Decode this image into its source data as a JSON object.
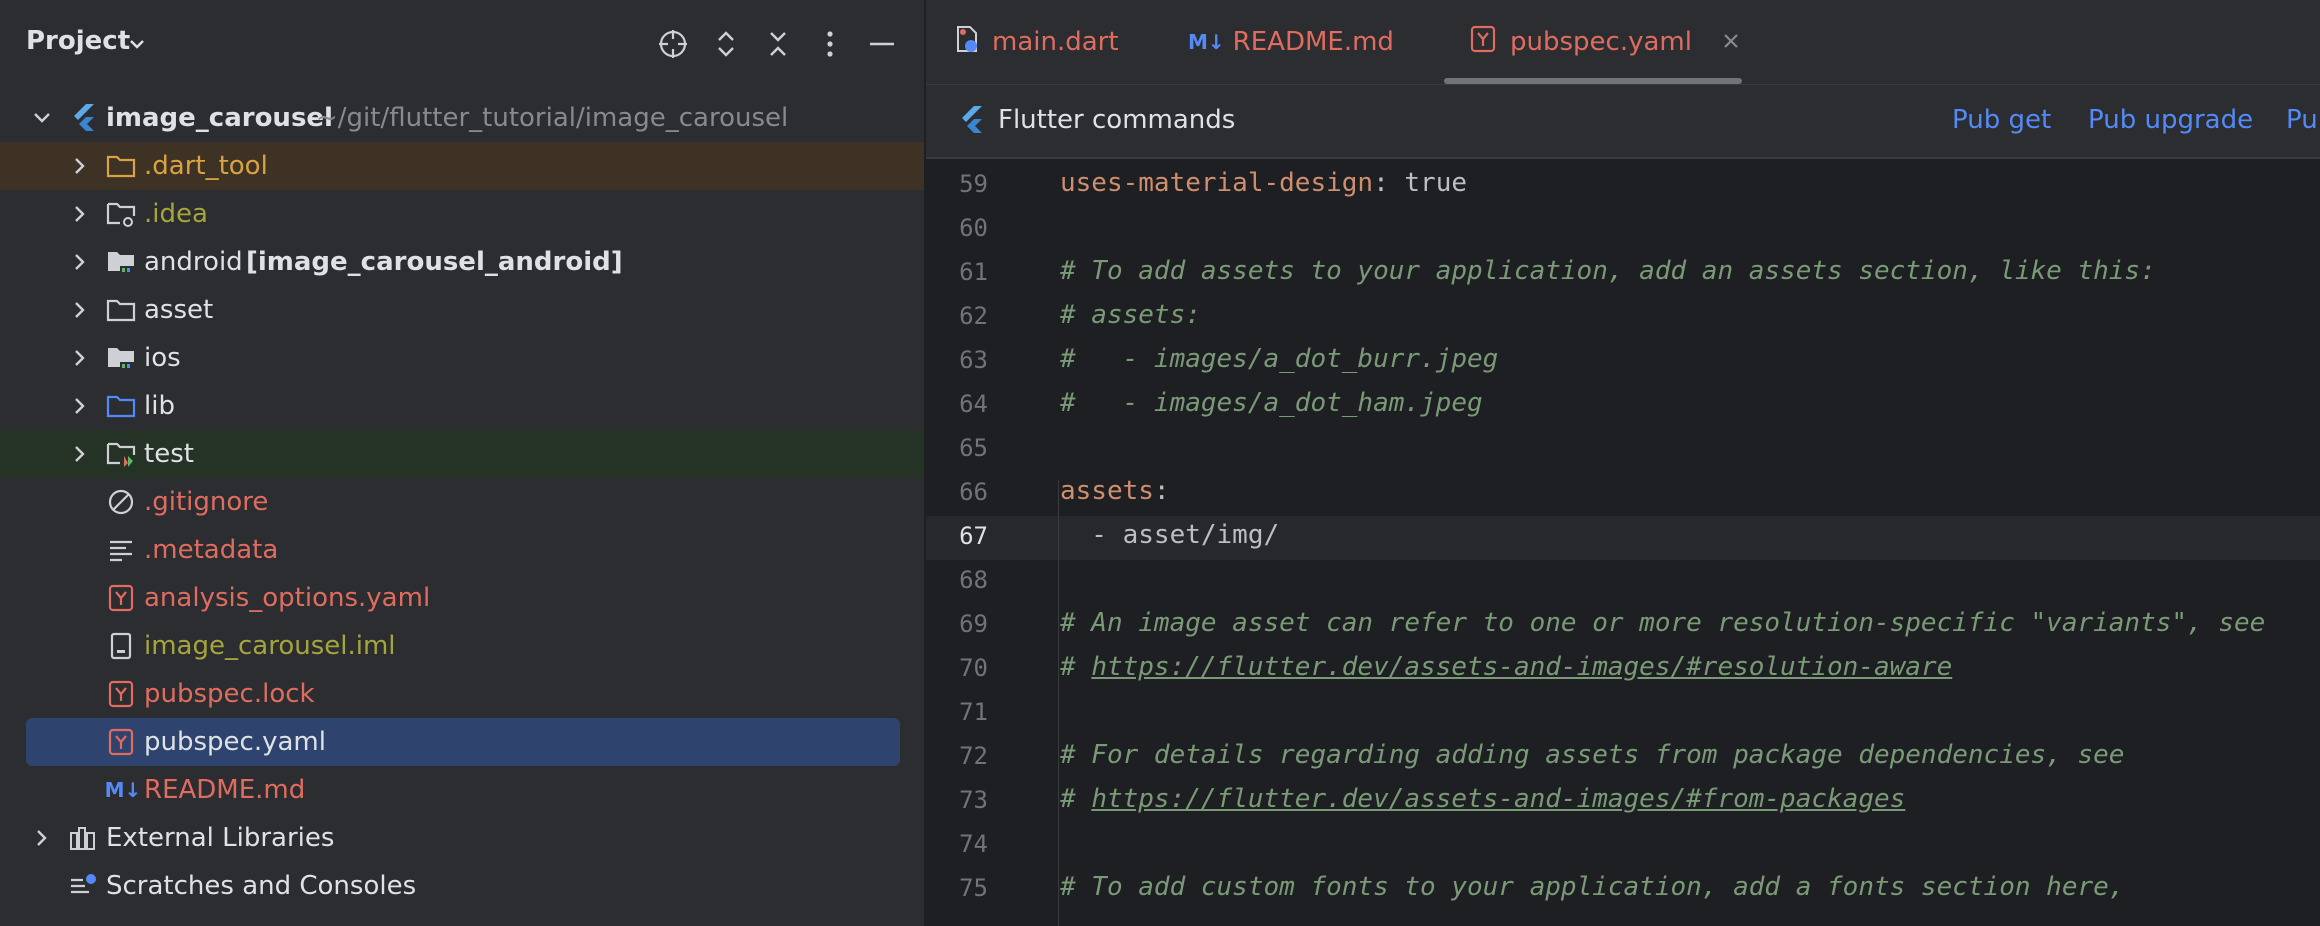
{
  "project_panel": {
    "title": "Project",
    "root": {
      "name": "image_carousel",
      "path": "~/git/flutter_tutorial/image_carousel"
    },
    "items": [
      {
        "label": ".dart_tool",
        "color": "#d9a343"
      },
      {
        "label": ".idea",
        "color": "#a6a43b"
      },
      {
        "label": "android",
        "extra": "[image_carousel_android]",
        "color": "#dfe1e5"
      },
      {
        "label": "asset",
        "color": "#dfe1e5"
      },
      {
        "label": "ios",
        "color": "#dfe1e5"
      },
      {
        "label": "lib",
        "color": "#dfe1e5"
      },
      {
        "label": "test",
        "color": "#dfe1e5"
      },
      {
        "label": ".gitignore",
        "color": "#e06c60"
      },
      {
        "label": ".metadata",
        "color": "#e06c60"
      },
      {
        "label": "analysis_options.yaml",
        "color": "#e06c60"
      },
      {
        "label": "image_carousel.iml",
        "color": "#a6a43b"
      },
      {
        "label": "pubspec.lock",
        "color": "#e06c60"
      },
      {
        "label": "pubspec.yaml",
        "color": "#dfe1e5"
      },
      {
        "label": "README.md",
        "color": "#e06c60"
      }
    ],
    "external_libraries": "External Libraries",
    "scratches": "Scratches and Consoles"
  },
  "editor": {
    "tabs": [
      {
        "label": "main.dart",
        "color": "#e06c60"
      },
      {
        "label": "README.md",
        "color": "#e06c60"
      },
      {
        "label": "pubspec.yaml",
        "color": "#e06c60",
        "active": true
      }
    ],
    "md_badge": "M↓",
    "toolbar": {
      "title": "Flutter commands",
      "pub_get": "Pub get",
      "pub_upgrade": "Pub upgrade",
      "pub_more": "Pu"
    },
    "current_line": "67",
    "lines": [
      {
        "n": "59",
        "key": "uses-material-design",
        "rest": ": true"
      },
      {
        "n": "60",
        "text": ""
      },
      {
        "n": "61",
        "comment": "# To add assets to your application, add an assets section, like this:"
      },
      {
        "n": "62",
        "comment": "# assets:"
      },
      {
        "n": "63",
        "comment": "#   - images/a_dot_burr.jpeg"
      },
      {
        "n": "64",
        "comment": "#   - images/a_dot_ham.jpeg"
      },
      {
        "n": "65",
        "text": ""
      },
      {
        "n": "66",
        "key": "assets",
        "rest": ":"
      },
      {
        "n": "67",
        "text": "  - asset/img/"
      },
      {
        "n": "68",
        "text": ""
      },
      {
        "n": "69",
        "comment": "# An image asset can refer to one or more resolution-specific \"variants\", see"
      },
      {
        "n": "70",
        "comment": "# ",
        "link": "https://flutter.dev/assets-and-images/#resolution-aware"
      },
      {
        "n": "71",
        "text": ""
      },
      {
        "n": "72",
        "comment": "# For details regarding adding assets from package dependencies, see"
      },
      {
        "n": "73",
        "comment": "# ",
        "link": "https://flutter.dev/assets-and-images/#from-packages"
      },
      {
        "n": "74",
        "text": ""
      },
      {
        "n": "75",
        "comment": "# To add custom fonts to your application, add a fonts section here,"
      }
    ]
  }
}
